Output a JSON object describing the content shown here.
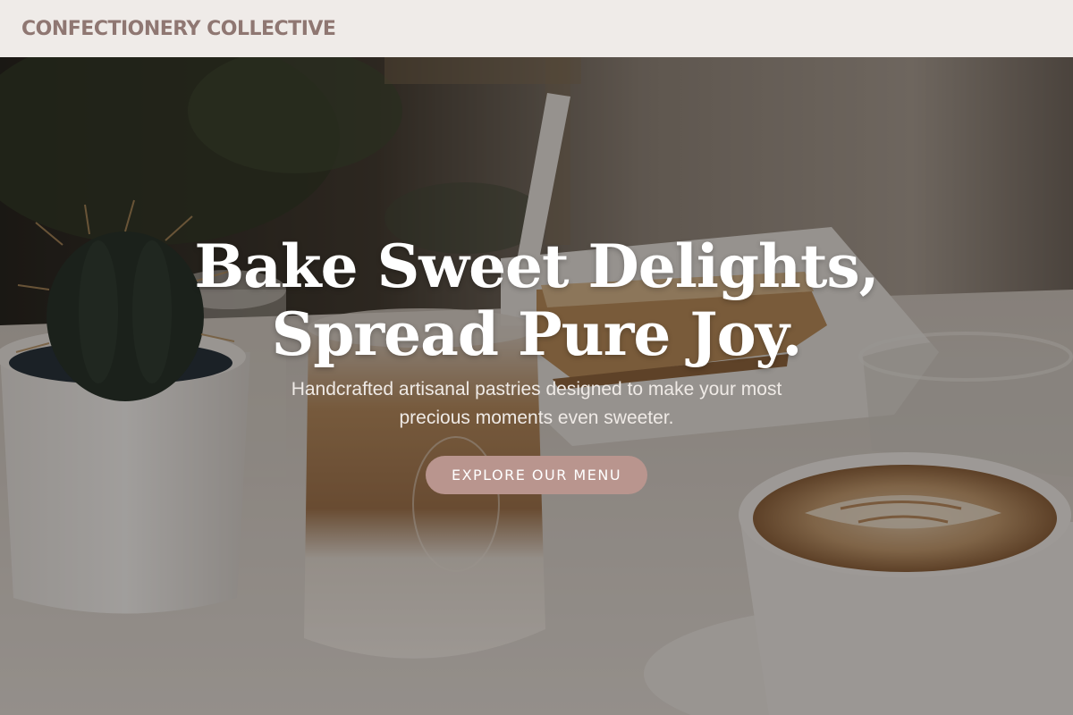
{
  "header": {
    "brand": "CONFECTIONERY COLLECTIVE"
  },
  "hero": {
    "title_line1": "Bake Sweet Delights,",
    "title_line2": "Spread Pure Joy.",
    "subtitle": "Handcrafted artisanal pastries designed to make your most precious moments even sweeter.",
    "cta_label": "EXPLORE OUR MENU"
  },
  "colors": {
    "header_bg": "#efebe8",
    "brand_text": "#8f7772",
    "cta_bg": "#b9958e",
    "overlay": "rgba(24,20,17,0.40)"
  }
}
